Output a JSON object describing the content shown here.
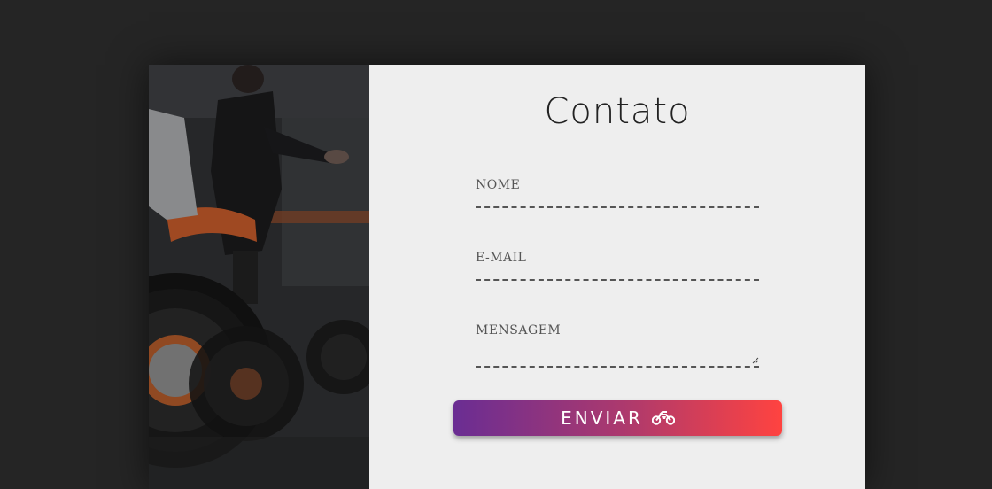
{
  "contact": {
    "title": "Contato",
    "fields": {
      "name_label": "NOME",
      "email_label": "E-MAIL",
      "message_label": "MENSAGEM"
    },
    "submit_label": "ENVIAR",
    "submit_icon": "motorcycle-icon"
  },
  "colors": {
    "page_background": "#252525",
    "panel_background": "#eeeeee",
    "button_gradient_start": "#6a2d93",
    "button_gradient_end": "#ff4340"
  },
  "photo": {
    "subject": "motorcycle-showroom-photo"
  }
}
